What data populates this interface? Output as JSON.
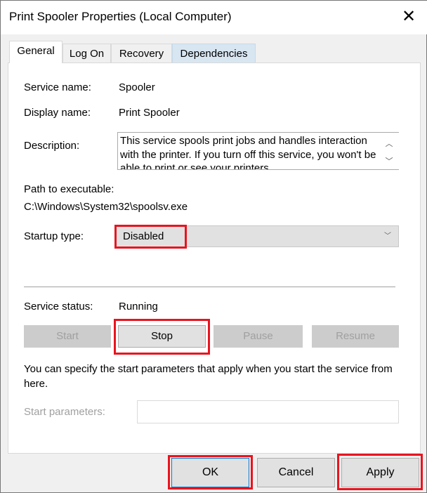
{
  "window": {
    "title": "Print Spooler Properties (Local Computer)",
    "close_icon": "close-icon"
  },
  "tabs": [
    {
      "label": "General",
      "selected": true
    },
    {
      "label": "Log On"
    },
    {
      "label": "Recovery"
    },
    {
      "label": "Dependencies",
      "hovered": true
    }
  ],
  "general": {
    "service_name_label": "Service name:",
    "service_name": "Spooler",
    "display_name_label": "Display name:",
    "display_name": "Print Spooler",
    "description_label": "Description:",
    "description": "This service spools print jobs and handles interaction with the printer.  If you turn off this service, you won't be able to print or see your printers.",
    "path_label": "Path to executable:",
    "path": "C:\\Windows\\System32\\spoolsv.exe",
    "startup_type_label": "Startup type:",
    "startup_type": "Disabled",
    "service_status_label": "Service status:",
    "service_status": "Running",
    "buttons": {
      "start": "Start",
      "stop": "Stop",
      "pause": "Pause",
      "resume": "Resume"
    },
    "params_hint": "You can specify the start parameters that apply when you start the service from here.",
    "start_params_label": "Start parameters:",
    "start_params_value": ""
  },
  "footer": {
    "ok": "OK",
    "cancel": "Cancel",
    "apply": "Apply"
  },
  "colors": {
    "highlight": "#e8141f",
    "hover_tab": "#d8e6f2"
  }
}
